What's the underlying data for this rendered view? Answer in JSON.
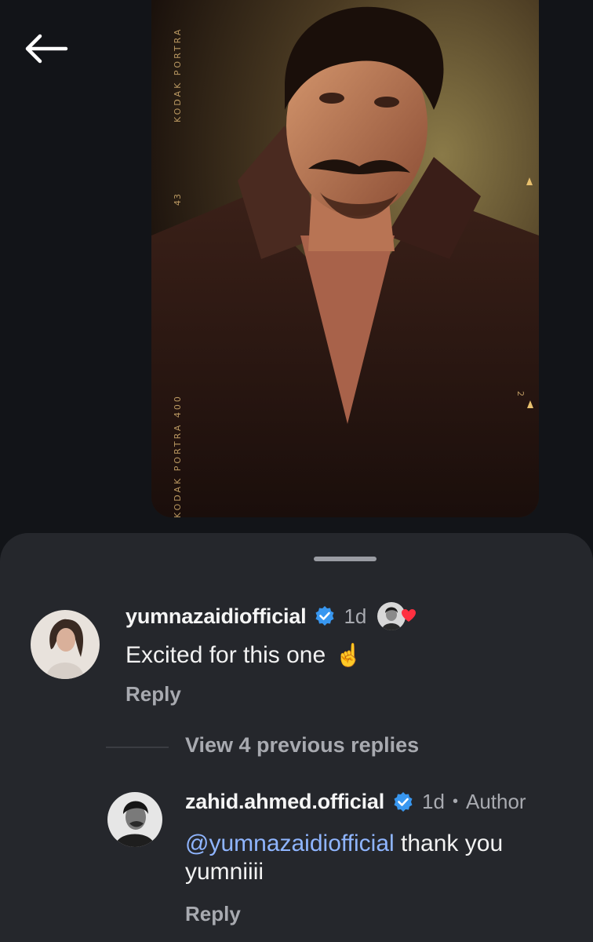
{
  "nav": {
    "back_icon": "arrow-left-icon"
  },
  "post": {
    "image_alt": "portrait photo",
    "film_text_top": "KODAK PORTRA",
    "film_frame_number": "43",
    "film_text_bottom": "KODAK PORTRA 400",
    "film_frame_number_right": "2"
  },
  "comments": [
    {
      "username": "yumnazaidiofficial",
      "verified": true,
      "time": "1d",
      "text": "Excited for this one",
      "emoji": "☝️",
      "liked_by_author": true,
      "reply_label": "Reply"
    }
  ],
  "replies_toggle": {
    "label": "View 4 previous replies"
  },
  "replies": [
    {
      "username": "zahid.ahmed.official",
      "verified": true,
      "time": "1d",
      "separator": "•",
      "badge": "Author",
      "mention": "@yumnazaidiofficial",
      "text": " thank you yumniiii",
      "reply_label": "Reply"
    }
  ],
  "colors": {
    "background": "#121418",
    "sheet": "#25272c",
    "verified_badge": "#3897f0",
    "mention": "#8fb5ff",
    "heart": "#ff3040",
    "muted_text": "#a8aab0"
  }
}
